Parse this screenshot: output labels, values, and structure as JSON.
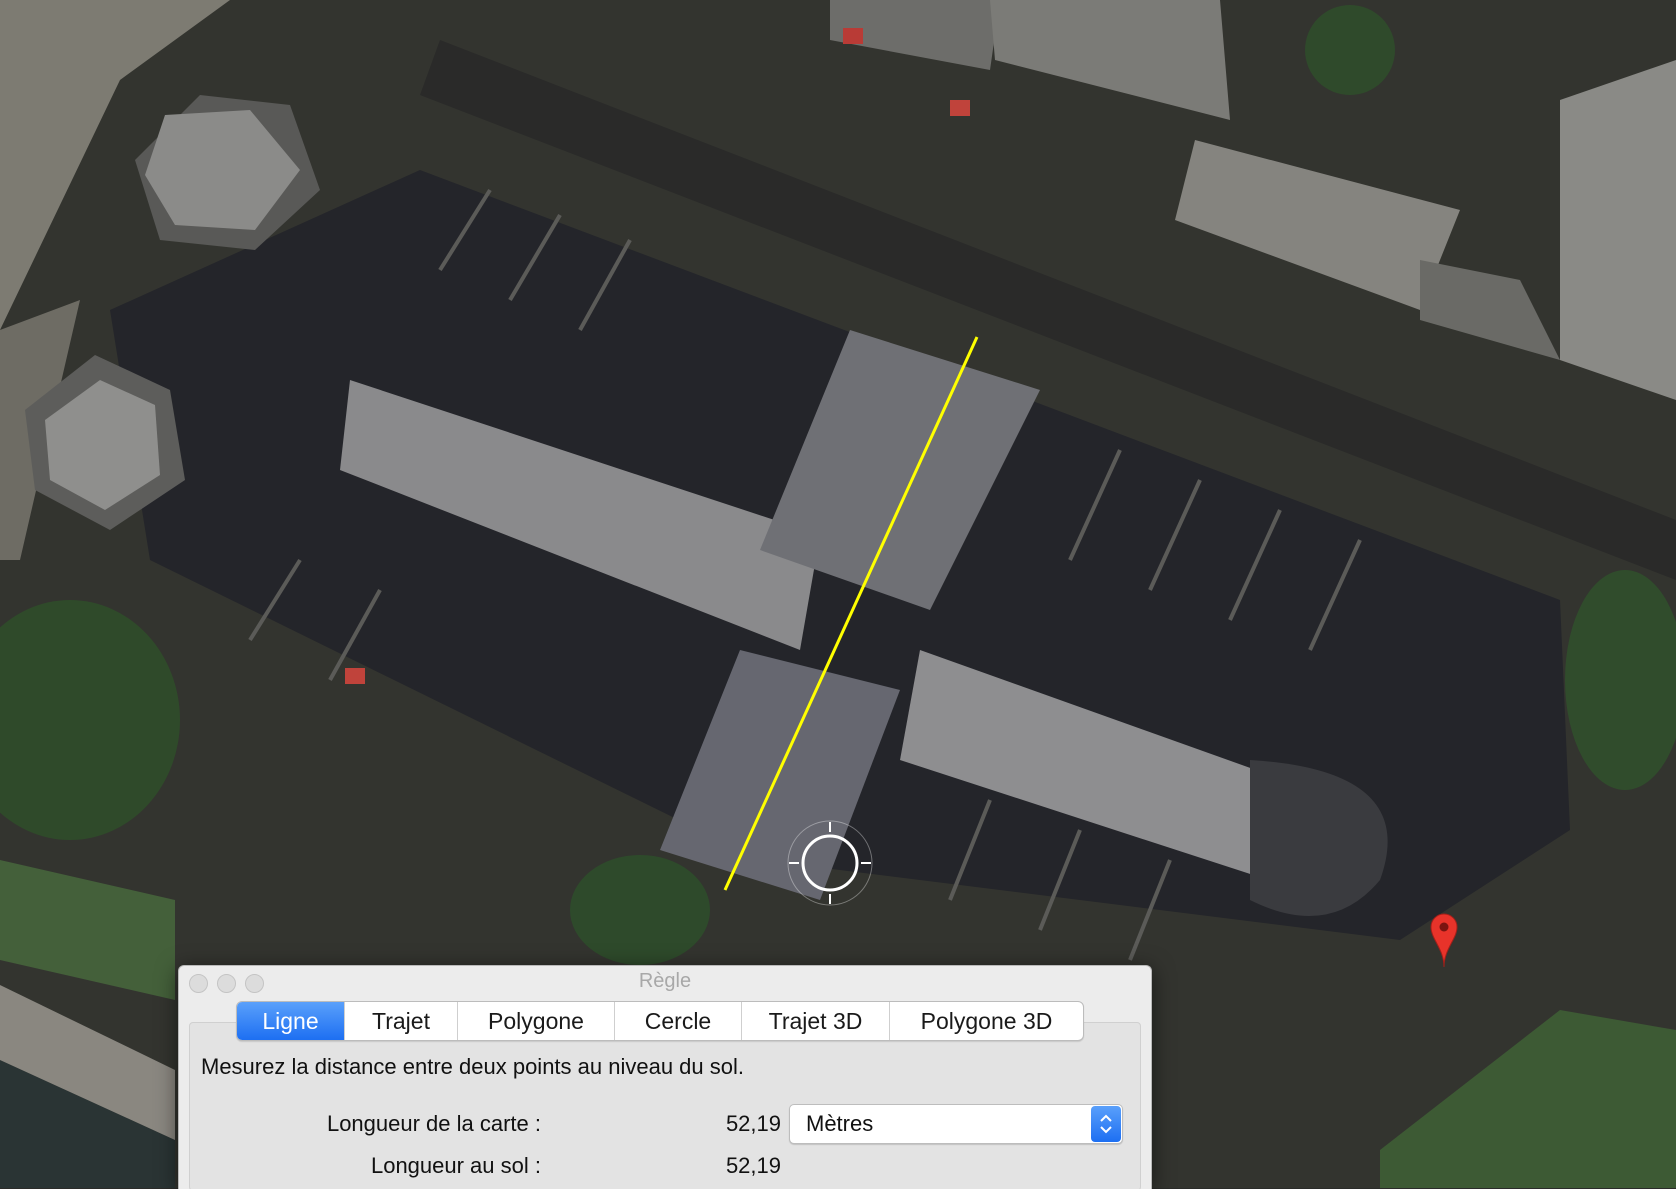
{
  "dialog": {
    "title": "Règle",
    "tabs": [
      {
        "label": "Ligne",
        "active": true
      },
      {
        "label": "Trajet",
        "active": false
      },
      {
        "label": "Polygone",
        "active": false
      },
      {
        "label": "Cercle",
        "active": false
      },
      {
        "label": "Trajet 3D",
        "active": false
      },
      {
        "label": "Polygone 3D",
        "active": false
      }
    ],
    "description": "Mesurez la distance entre deux points au niveau du sol.",
    "map_length_label": "Longueur de la carte :",
    "map_length_value": "52,19",
    "ground_length_label": "Longueur au sol :",
    "ground_length_value": "52,19",
    "unit_selected": "Mètres"
  },
  "colors": {
    "measure_line": "#ffff00",
    "accent": "#1d6ff2",
    "placemark": "#e8332a"
  },
  "icons": {
    "crosshair": "crosshair-icon",
    "placemark": "map-pin-icon",
    "select": "chevron-up-down-icon"
  }
}
